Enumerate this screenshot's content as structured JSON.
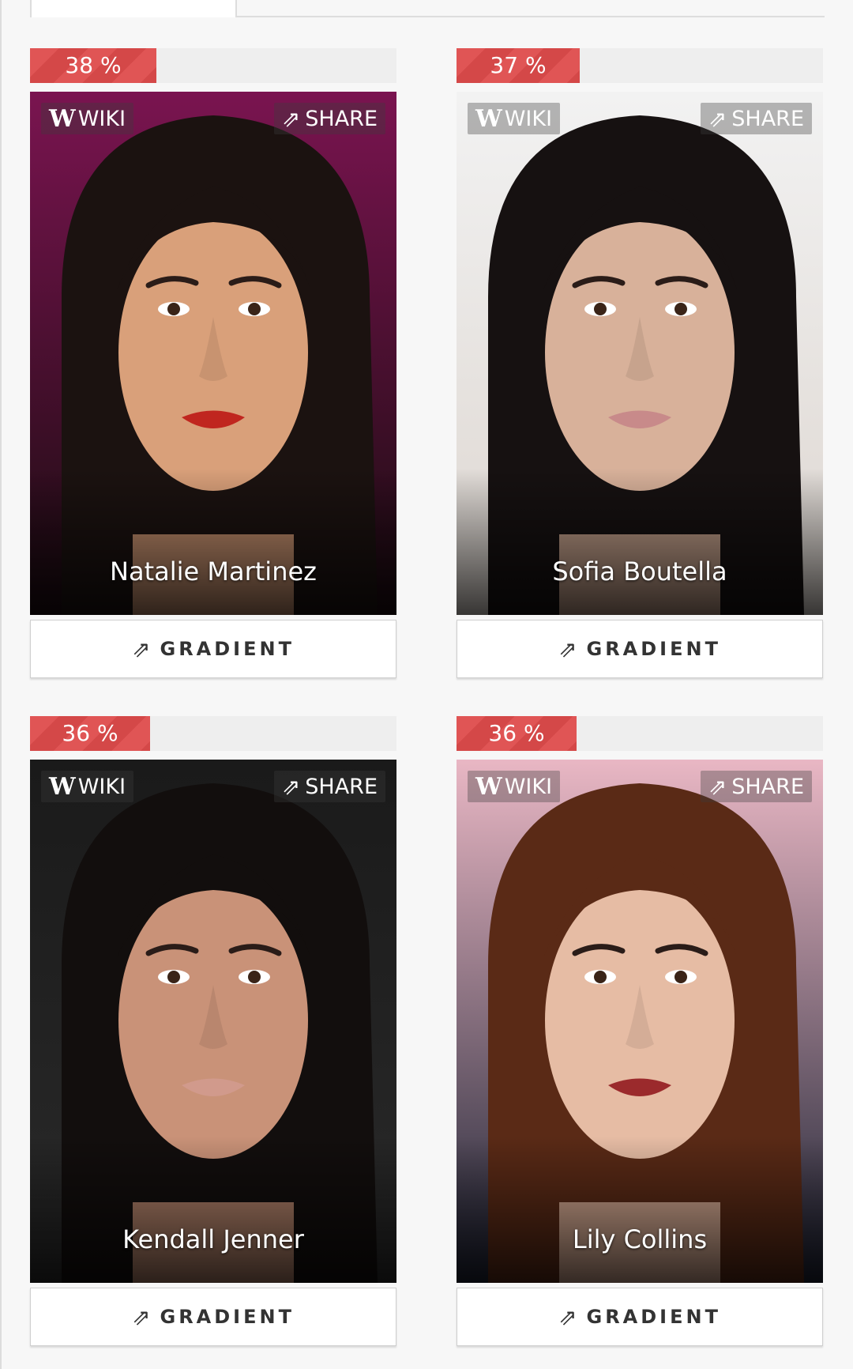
{
  "cards": [
    {
      "percent_label": "38 %",
      "percent": 38,
      "name": "Natalie Martinez",
      "wiki_label": "WIKI",
      "wiki_glyph": "W",
      "share_label": "SHARE",
      "gradient_label": "GRADIENT",
      "bg_top": "#7a1450",
      "bg_bottom": "#1a0b10",
      "hair": "#1b1210",
      "skin": "#d9a07a",
      "lips": "#c0261f"
    },
    {
      "percent_label": "37 %",
      "percent": 37,
      "name": "Sofia Boutella",
      "wiki_label": "WIKI",
      "wiki_glyph": "W",
      "share_label": "SHARE",
      "gradient_label": "GRADIENT",
      "bg_top": "#f2f2f2",
      "bg_bottom": "#ddd6d0",
      "hair": "#161111",
      "skin": "#d8b19a",
      "lips": "#c88a8a"
    },
    {
      "percent_label": "36 %",
      "percent": 36,
      "name": "Kendall Jenner",
      "wiki_label": "WIKI",
      "wiki_glyph": "W",
      "share_label": "SHARE",
      "gradient_label": "GRADIENT",
      "bg_top": "#1a1a1a",
      "bg_bottom": "#2a2a2a",
      "hair": "#120e0d",
      "skin": "#c99278",
      "lips": "#d19a8c"
    },
    {
      "percent_label": "36 %",
      "percent": 36,
      "name": "Lily Collins",
      "wiki_label": "WIKI",
      "wiki_glyph": "W",
      "share_label": "SHARE",
      "gradient_label": "GRADIENT",
      "bg_top": "#e9b7c4",
      "bg_bottom": "#1d2233",
      "hair": "#5a2a16",
      "skin": "#e6bca4",
      "lips": "#9b2a2c"
    }
  ],
  "icons": {
    "wiki": "wikipedia-w-icon",
    "share": "share-icon",
    "gradient": "share-icon"
  }
}
